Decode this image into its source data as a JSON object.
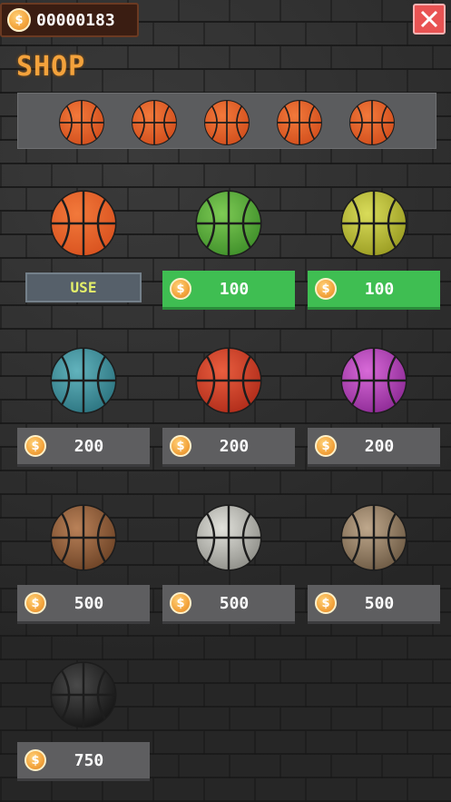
{
  "header": {
    "coin_count": "00000183",
    "coin_symbol": "$",
    "close_icon": "close-icon"
  },
  "shop": {
    "title": "SHOP"
  },
  "preview": {
    "balls": [
      "orange",
      "orange",
      "orange",
      "orange",
      "orange"
    ]
  },
  "items": [
    {
      "ball": "orange",
      "action": "USE",
      "colors": [
        "#f2793b",
        "#d9521f"
      ]
    },
    {
      "ball": "green",
      "price": "100",
      "colors": [
        "#7ecb55",
        "#3f8f2a"
      ]
    },
    {
      "ball": "yellow",
      "price": "100",
      "colors": [
        "#d9dc5a",
        "#9a9c22"
      ]
    },
    {
      "ball": "teal",
      "price": "200",
      "colors": [
        "#62b3bd",
        "#2c7480"
      ]
    },
    {
      "ball": "red",
      "price": "200",
      "colors": [
        "#ea5e3f",
        "#b02c1a"
      ]
    },
    {
      "ball": "purple",
      "price": "200",
      "colors": [
        "#d86ad8",
        "#8d2a95"
      ]
    },
    {
      "ball": "wood",
      "price": "500",
      "colors": [
        "#b98158",
        "#6d4326"
      ]
    },
    {
      "ball": "silver",
      "price": "500",
      "colors": [
        "#e2e2dc",
        "#8e8e88"
      ]
    },
    {
      "ball": "stone",
      "price": "500",
      "colors": [
        "#bfa88c",
        "#6d5a44"
      ]
    },
    {
      "ball": "dark",
      "price": "750",
      "colors": [
        "#4a4a4a",
        "#151515"
      ]
    }
  ],
  "colors": {
    "accent_orange": "#f3a23c",
    "buy_green": "#3fbe52",
    "close_red": "#e95353",
    "use_text": "#e4f06a"
  }
}
